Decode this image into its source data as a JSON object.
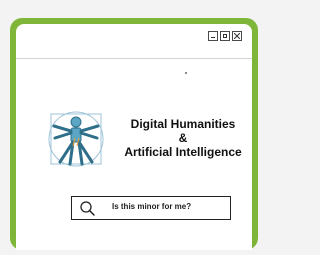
{
  "title": {
    "line1": "Digital Humanities",
    "line2": "&",
    "line3": "Artificial Intelligence"
  },
  "search": {
    "text": "Is this minor for me?"
  },
  "colors": {
    "frame": "#7fb63a",
    "logo": "#5aa6c4"
  },
  "icons": [
    "minimize-icon",
    "maximize-icon",
    "close-icon",
    "vitruvian-robot-logo",
    "search-icon"
  ]
}
